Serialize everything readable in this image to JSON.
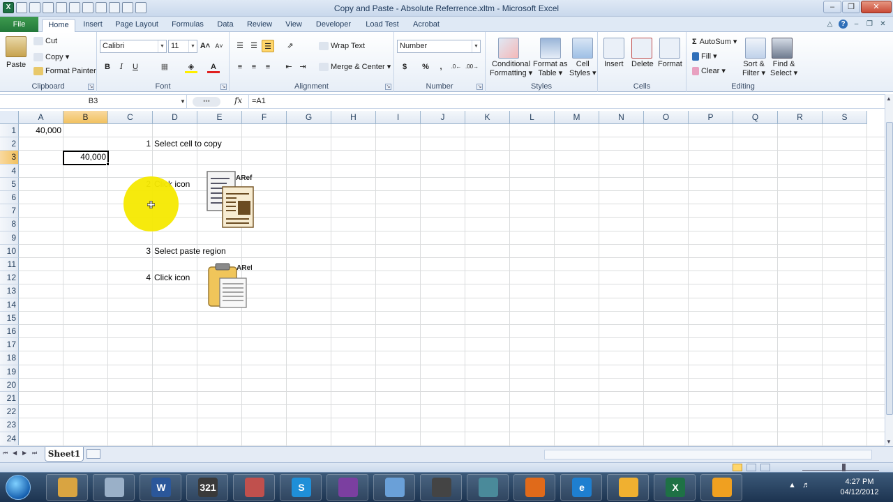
{
  "window": {
    "title": "Copy and Paste - Absolute Referrence.xltm - Microsoft Excel"
  },
  "tabs": [
    "File",
    "Home",
    "Insert",
    "Page Layout",
    "Formulas",
    "Data",
    "Review",
    "View",
    "Developer",
    "Load Test",
    "Acrobat"
  ],
  "ribbon": {
    "clipboard": {
      "label": "Clipboard",
      "paste": "Paste",
      "cut": "Cut",
      "copy": "Copy",
      "format_painter": "Format Painter"
    },
    "font": {
      "label": "Font",
      "font_name": "Calibri",
      "font_size": "11",
      "bold": "B",
      "italic": "I",
      "underline": "U"
    },
    "alignment": {
      "label": "Alignment",
      "wrap_text": "Wrap Text",
      "merge_center": "Merge & Center"
    },
    "number": {
      "label": "Number",
      "format": "Number",
      "currency": "$",
      "percent": "%",
      "comma": ","
    },
    "styles": {
      "label": "Styles",
      "conditional_1": "Conditional",
      "conditional_2": "Formatting",
      "format_table_1": "Format as",
      "format_table_2": "Table",
      "cell_styles_1": "Cell",
      "cell_styles_2": "Styles"
    },
    "cells": {
      "label": "Cells",
      "insert": "Insert",
      "delete": "Delete",
      "format": "Format"
    },
    "editing": {
      "label": "Editing",
      "autosum": "AutoSum",
      "fill": "Fill",
      "clear": "Clear",
      "sort_1": "Sort &",
      "sort_2": "Filter",
      "find_1": "Find &",
      "find_2": "Select"
    }
  },
  "formula_bar": {
    "name_box": "B3",
    "fx": "fx",
    "formula": "=A1"
  },
  "columns": [
    "A",
    "B",
    "C",
    "D",
    "E",
    "F",
    "G",
    "H",
    "I",
    "J",
    "K",
    "L",
    "M",
    "N",
    "O",
    "P",
    "Q",
    "R",
    "S"
  ],
  "rows": [
    "1",
    "2",
    "3",
    "4",
    "5",
    "6",
    "7",
    "8",
    "9",
    "10",
    "11",
    "12",
    "13",
    "14",
    "15",
    "16",
    "17",
    "18",
    "19",
    "20",
    "21",
    "22",
    "23",
    "24"
  ],
  "selected": {
    "column": "B",
    "row": "3"
  },
  "cells": {
    "A1": "40,000",
    "B3": "40,000",
    "C2": "1",
    "D2": "Select cell to copy",
    "C5": "2",
    "D5": "Click icon",
    "C10": "3",
    "D10": "Select paste region",
    "C12": "4",
    "D12": "Click icon"
  },
  "icons": {
    "copy_icon_badge": "ARef",
    "paste_icon_badge": "ARef"
  },
  "sheet_tabs": [
    "Sheet1"
  ],
  "taskbar": {
    "time": "4:27 PM",
    "date": "04/12/2012",
    "apps": [
      "explorer-icon",
      "notes-icon",
      "word-icon",
      "calendar-icon",
      "media-icon",
      "skype-icon",
      "app-icon",
      "app2-icon",
      "app3-icon",
      "app4-icon",
      "firefox-icon",
      "ie-icon",
      "outlook-icon",
      "excel-icon",
      "app5-icon"
    ]
  },
  "colors": {
    "file_tab": "#2a7f3e",
    "highlight": "#f5e900",
    "accent_selected_header": "#f1c15f"
  }
}
